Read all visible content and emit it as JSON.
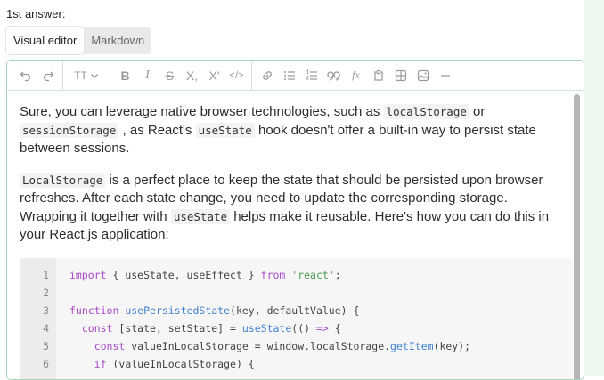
{
  "answer_label": "1st answer:",
  "mode_tabs": [
    {
      "label": "Visual editor",
      "active": true
    },
    {
      "label": "Markdown",
      "active": false
    }
  ],
  "toolbar": {
    "groups": [
      [
        "undo-icon",
        "redo-icon"
      ],
      [
        "text-size-icon"
      ],
      [
        "bold-icon",
        "italic-icon",
        "strikethrough-icon",
        "subscript-icon",
        "superscript-icon",
        "code-icon"
      ],
      [
        "link-icon",
        "bullet-list-icon",
        "numbered-list-icon",
        "quote-icon",
        "formula-icon",
        "paste-icon",
        "table-icon",
        "image-icon",
        "divider-icon"
      ]
    ],
    "text_size_glyph": "TT",
    "bold_glyph": "B",
    "italic_glyph": "I",
    "strike_glyph": "S",
    "sub_glyph": "X,",
    "sup_glyph": "X'",
    "code_glyph": "</>",
    "formula_glyph": "fx"
  },
  "content": {
    "p1": {
      "t1": "Sure, you can leverage native browser technologies, such as ",
      "c1": "localStorage",
      "t2": " or ",
      "c2": "sessionStorage",
      "t3": " , as React's ",
      "c3": "useState",
      "t4": " hook doesn't offer a built-in way to persist state between sessions."
    },
    "p2": {
      "c1": "LocalStorage",
      "t1": " is a perfect place to keep the state that should be persisted upon browser refreshes. After each state change, you need to update the corresponding storage. Wrapping it together with ",
      "c2": "useState",
      "t2": " helps make it reusable. Here's how you can do this in your React.js application:"
    }
  },
  "code": {
    "lines": [
      {
        "n": "1",
        "segments": [
          [
            "kw",
            "import"
          ],
          [
            "",
            "{ useState, useEffect } "
          ],
          [
            "kw",
            "from"
          ],
          [
            "",
            " "
          ],
          [
            "str",
            "'react'"
          ],
          [
            "",
            ";"
          ]
        ]
      },
      {
        "n": "2",
        "segments": []
      },
      {
        "n": "3",
        "segments": [
          [
            "kw",
            "function"
          ],
          [
            "",
            " "
          ],
          [
            "fn",
            "usePersistedState"
          ],
          [
            "",
            "(key, defaultValue) {"
          ]
        ]
      },
      {
        "n": "4",
        "segments": [
          [
            "",
            "  "
          ],
          [
            "kw",
            "const"
          ],
          [
            "",
            " [state, setState] = "
          ],
          [
            "fn",
            "useState"
          ],
          [
            "",
            "(() "
          ],
          [
            "kw",
            "=>"
          ],
          [
            "",
            " {"
          ]
        ]
      },
      {
        "n": "5",
        "segments": [
          [
            "",
            "    "
          ],
          [
            "kw",
            "const"
          ],
          [
            "",
            " valueInLocalStorage = window.localStorage."
          ],
          [
            "fn",
            "getItem"
          ],
          [
            "",
            "(key);"
          ]
        ]
      },
      {
        "n": "6",
        "segments": [
          [
            "",
            "    "
          ],
          [
            "kw",
            "if"
          ],
          [
            "",
            " (valueInLocalStorage) {"
          ]
        ]
      }
    ]
  }
}
